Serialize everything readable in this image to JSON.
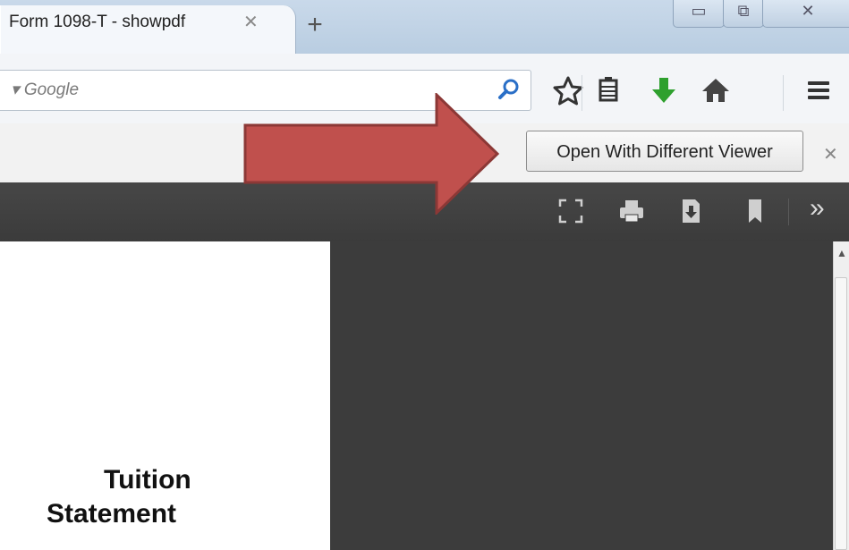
{
  "tab": {
    "title": "Form 1098-T - showpdf",
    "close_glyph": "✕",
    "new_tab_glyph": "+"
  },
  "window_controls": {
    "minimize": "▭",
    "maximize": "⧉",
    "close": "✕"
  },
  "search": {
    "engine_prefix": "▾ Google",
    "icon": "magnifier-icon"
  },
  "toolbar_icons": [
    "star-icon",
    "bookmarks-list-icon",
    "download-icon",
    "home-icon",
    "menu-icon"
  ],
  "notification": {
    "button_label": "Open With Different Viewer",
    "close_glyph": "✕"
  },
  "pdf_toolbar": {
    "icons": [
      "presentation-mode-icon",
      "print-icon",
      "download-icon",
      "bookmark-icon"
    ],
    "more_glyph": "»"
  },
  "document": {
    "title_line1": "Tuition",
    "title_line2": "Statement"
  },
  "colors": {
    "arrow_fill": "#c0504d",
    "arrow_stroke": "#8c3836",
    "download_green": "#2ea02e",
    "viewer_bg": "#3c3c3c"
  }
}
